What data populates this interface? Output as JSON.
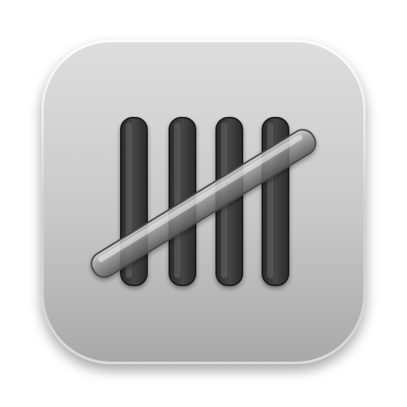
{
  "icon": {
    "name": "tally-marks-icon",
    "tally_count": 5,
    "colors": {
      "tile_top": "#dcdcdc",
      "tile_bottom": "#a9a9a9",
      "stroke_dark": "#2e2e2e",
      "stroke_mid": "#4a4a4a",
      "strike_glass": "#9a9a9a",
      "highlight": "#ffffff"
    }
  }
}
